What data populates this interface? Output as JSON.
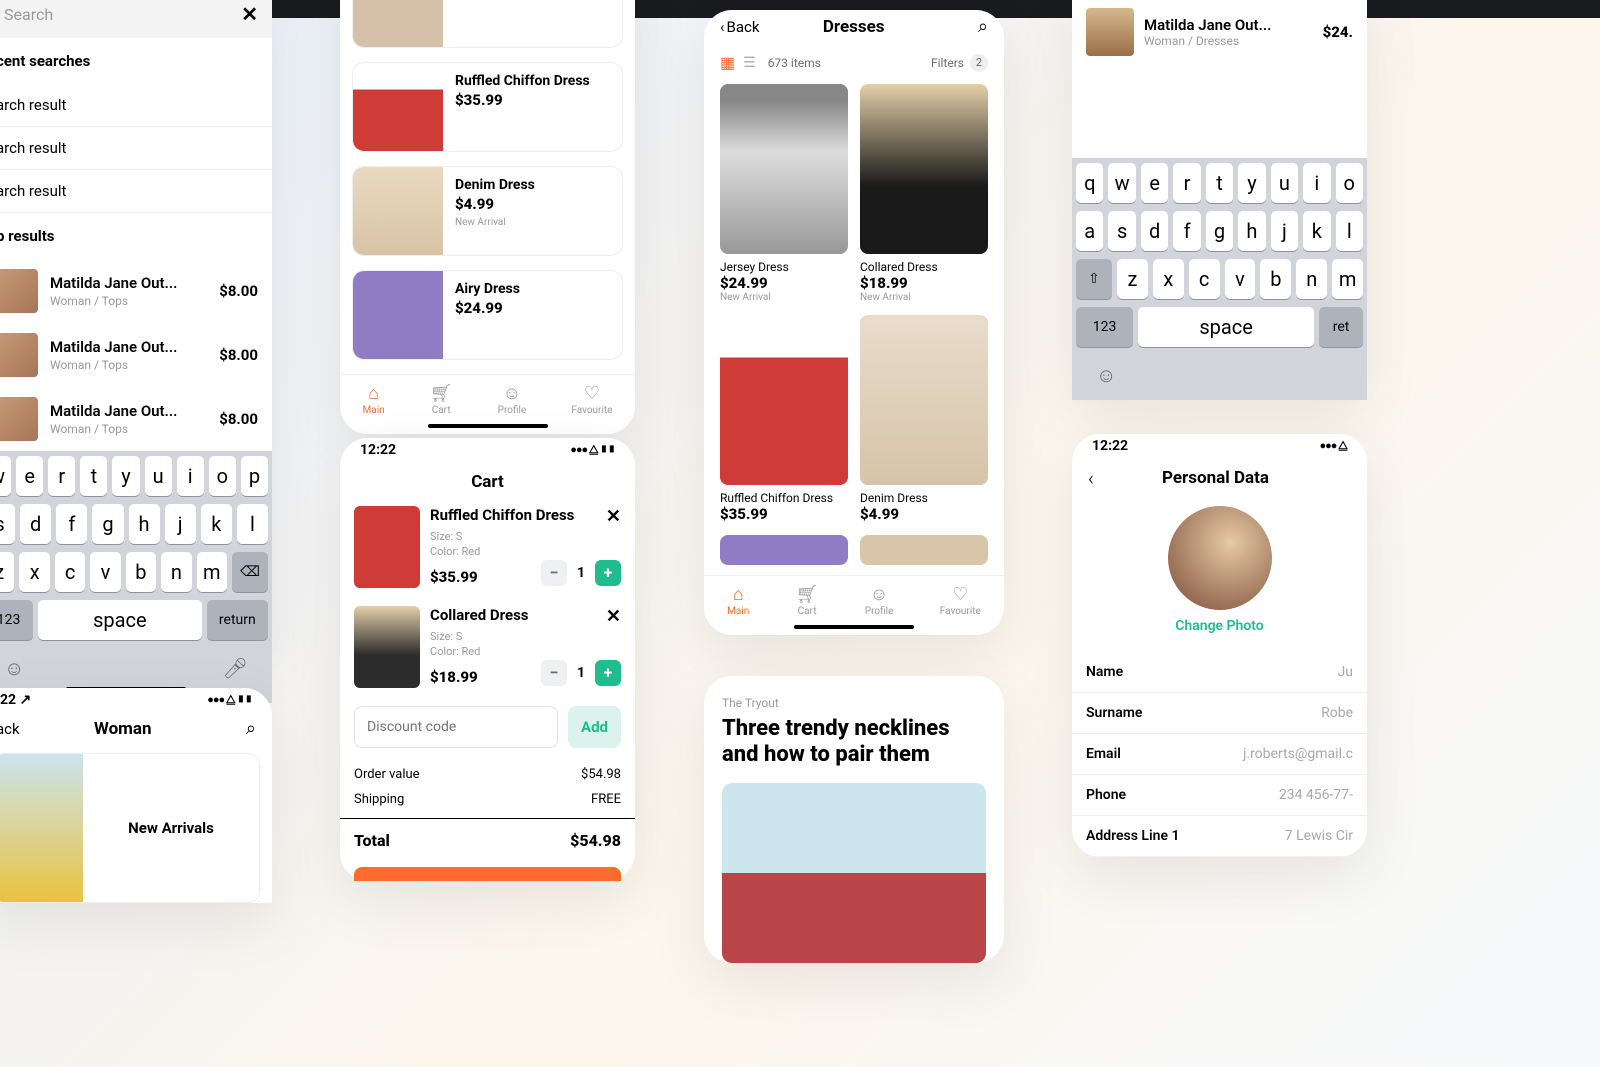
{
  "search": {
    "placeholder": "Search",
    "recent_title": "cent searches",
    "recent": [
      "arch result",
      "arch result",
      "arch result"
    ],
    "top_title": "p results",
    "items": [
      {
        "name": "Matilda Jane Out...",
        "cat": "Woman / Tops",
        "price": "$8.00"
      },
      {
        "name": "Matilda Jane Out...",
        "cat": "Woman / Tops",
        "price": "$8.00"
      },
      {
        "name": "Matilda Jane Out...",
        "cat": "Woman / Tops",
        "price": "$8.00"
      }
    ]
  },
  "keyboard": {
    "r1": [
      "q",
      "w",
      "e",
      "r",
      "t",
      "y",
      "u",
      "i",
      "o",
      "p"
    ],
    "r2": [
      "a",
      "s",
      "d",
      "f",
      "g",
      "h",
      "j",
      "k",
      "l"
    ],
    "r3": [
      "z",
      "x",
      "c",
      "v",
      "b",
      "n",
      "m"
    ],
    "num": "123",
    "space": "space",
    "ret": "return"
  },
  "prodlist": {
    "items": [
      {
        "title": "",
        "price": "",
        "tag": "New Arrival"
      },
      {
        "title": "Ruffled Chiffon Dress",
        "price": "$35.99",
        "tag": ""
      },
      {
        "title": "Denim Dress",
        "price": "$4.99",
        "tag": "New Arrival"
      },
      {
        "title": "Airy Dress",
        "price": "$24.99",
        "tag": ""
      }
    ]
  },
  "nav": {
    "main": "Main",
    "cart": "Cart",
    "profile": "Profile",
    "fav": "Favourite"
  },
  "status": {
    "time": "12:22"
  },
  "cart": {
    "title": "Cart",
    "items": [
      {
        "title": "Ruffled Chiffon Dress",
        "size": "Size: S",
        "color": "Color: Red",
        "price": "$35.99",
        "qty": "1"
      },
      {
        "title": "Collared Dress",
        "size": "Size: S",
        "color": "Color: Red",
        "price": "$18.99",
        "qty": "1"
      }
    ],
    "discount_ph": "Discount code",
    "add": "Add",
    "order_label": "Order value",
    "order_val": "$54.98",
    "ship_label": "Shipping",
    "ship_val": "FREE",
    "total_label": "Total",
    "total_val": "$54.98"
  },
  "dresses": {
    "back": "Back",
    "title": "Dresses",
    "count": "673 items",
    "filters": "Filters",
    "filter_badge": "2",
    "grid": [
      {
        "title": "Jersey Dress",
        "price": "$24.99",
        "tag": "New Arrival"
      },
      {
        "title": "Collared Dress",
        "price": "$18.99",
        "tag": "New Arrival"
      },
      {
        "title": "Ruffled Chiffon Dress",
        "price": "$35.99",
        "tag": ""
      },
      {
        "title": "Denim Dress",
        "price": "$4.99",
        "tag": ""
      }
    ]
  },
  "article": {
    "eyebrow": "The Tryout",
    "title": "Three trendy necklines and how to pair them"
  },
  "woman": {
    "back": "ack",
    "title": "Woman",
    "card": "New Arrivals"
  },
  "r_search": {
    "name": "Matilda Jane Out...",
    "cat": "Woman / Dresses",
    "price": "$24."
  },
  "profile": {
    "title": "Personal Data",
    "change": "Change Photo",
    "fields": [
      {
        "l": "Name",
        "v": "Ju"
      },
      {
        "l": "Surname",
        "v": "Robe"
      },
      {
        "l": "Email",
        "v": "j.roberts@gmail.c"
      },
      {
        "l": "Phone",
        "v": "234 456-77-"
      },
      {
        "l": "Address Line 1",
        "v": "7 Lewis Cir"
      }
    ]
  }
}
